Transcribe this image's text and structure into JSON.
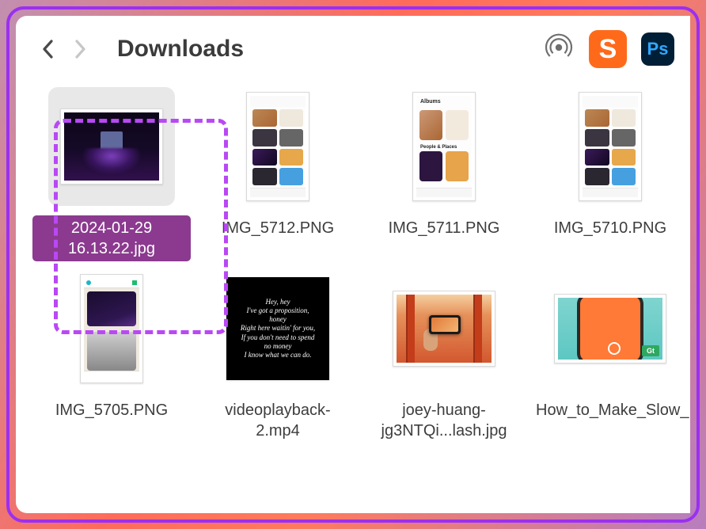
{
  "header": {
    "title": "Downloads",
    "back_enabled": true,
    "forward_enabled": false
  },
  "toolbar_apps": {
    "airdrop": "airdrop",
    "app_s": "S",
    "app_ps": "Ps"
  },
  "files": [
    {
      "name": "2024-01-29 16.13.22.jpg",
      "selected": true,
      "thumb": "dark-desk",
      "shape": "landscape"
    },
    {
      "name": "IMG_5712.PNG",
      "selected": false,
      "thumb": "phone-grid",
      "shape": "portrait"
    },
    {
      "name": "IMG_5711.PNG",
      "selected": false,
      "thumb": "albums",
      "shape": "portrait"
    },
    {
      "name": "IMG_5710.PNG",
      "selected": false,
      "thumb": "phone-grid",
      "shape": "portrait"
    },
    {
      "name": "IMG_5705.PNG",
      "selected": false,
      "thumb": "chat",
      "shape": "portrait"
    },
    {
      "name": "videoplayback-2.mp4",
      "selected": false,
      "thumb": "video",
      "shape": "square"
    },
    {
      "name": "joey-huang-jg3NTQi...lash.jpg",
      "selected": false,
      "thumb": "torii",
      "shape": "landscape"
    },
    {
      "name": "How_to_Make_Slow_Mo_...hone.jpg",
      "selected": false,
      "thumb": "slowmo",
      "shape": "landscape-wide"
    }
  ],
  "video_lyrics": {
    "l1": "Hey, hey",
    "l2": "I've got a proposition,",
    "l3": "honey",
    "l4": "Right here waitin' for you,",
    "l5": "If you don't need to spend",
    "l6": "no money",
    "l7": "I know what we can do."
  },
  "albums_label": "Albums",
  "people_label": "People & Places",
  "gt_badge": "Gt"
}
